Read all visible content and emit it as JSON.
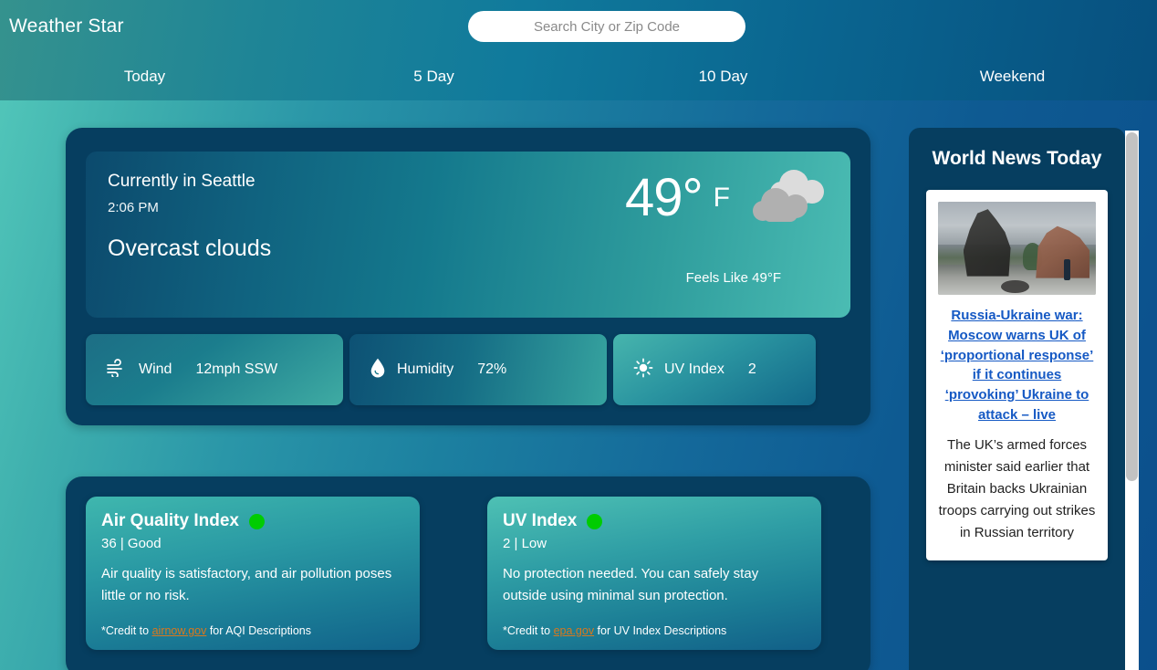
{
  "app": {
    "brand": "Weather Star"
  },
  "search": {
    "placeholder": "Search City or Zip Code",
    "value": ""
  },
  "nav": {
    "tabs": [
      {
        "label": "Today"
      },
      {
        "label": "5 Day"
      },
      {
        "label": "10 Day"
      },
      {
        "label": "Weekend"
      }
    ]
  },
  "current": {
    "city_line": "Currently in Seattle",
    "time": "2:06 PM",
    "condition": "Overcast clouds",
    "temperature": "49°",
    "unit": "F",
    "feels_like": "Feels Like 49°F",
    "icon": "overcast-clouds-icon"
  },
  "stats": [
    {
      "icon": "wind-icon",
      "label": "Wind",
      "value": "12mph SSW"
    },
    {
      "icon": "humidity-icon",
      "label": "Humidity",
      "value": "72%"
    },
    {
      "icon": "sun-icon",
      "label": "UV Index",
      "value": "2"
    }
  ],
  "indexes": [
    {
      "title": "Air Quality Index",
      "status_color": "#00cc00",
      "sub": "36 | Good",
      "description": "Air quality is satisfactory, and air pollution poses little or no risk.",
      "credit_prefix": "*Credit to ",
      "credit_link": "airnow.gov",
      "credit_suffix": " for AQI Descriptions"
    },
    {
      "title": "UV Index",
      "status_color": "#00cc00",
      "sub": "2 | Low",
      "description": "No protection needed. You can safely stay outside using minimal sun protection.",
      "credit_prefix": "*Credit to ",
      "credit_link": "epa.gov",
      "credit_suffix": " for UV Index Descriptions"
    }
  ],
  "news": {
    "title": "World News Today",
    "headline": "Russia-Ukraine war: Moscow warns UK of ‘proportional response’ if it continues ‘provoking’ Ukraine to attack – live",
    "body": "The UK’s armed forces minister said earlier that Britain backs Ukrainian troops carrying out strikes in Russian territory",
    "image_alt": "bronze-statue-monument-photo"
  },
  "colors": {
    "accent_teal": "#3fb7ae",
    "deep_blue": "#063e60",
    "link_blue": "#1559c4",
    "credit_orange": "#d9781d",
    "status_green": "#00cc00"
  }
}
